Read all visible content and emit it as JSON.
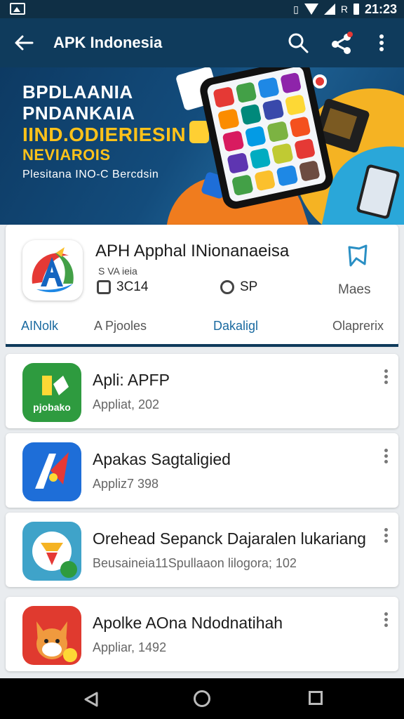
{
  "status_bar": {
    "time": "21:23",
    "vibrate_icon": "vibrate-icon",
    "data_icon": "R"
  },
  "app_bar": {
    "title": "APK Indonesia",
    "icons": [
      "back-arrow-icon",
      "search-icon",
      "share-icon",
      "more-vertical-icon"
    ]
  },
  "banner": {
    "lines": [
      "BPDLAANIA",
      "PNDANKAIA",
      "IIND.ODIERIESIN",
      "NEVIAROIS",
      "Plesitana INO-C Bercdsin"
    ]
  },
  "featured": {
    "name": "APH Apphal INionanaeisa",
    "sub": "S VA ieia",
    "rating": "3C14",
    "size": "SP",
    "bookmark_label": "Maes",
    "tabs": [
      "AINolk",
      "A Pjooles",
      "Dakaligl",
      "Olaprerix"
    ],
    "accent": "#1a6aa0"
  },
  "apps": [
    {
      "name": "Apli: APFP",
      "meta": "Appliat, 202",
      "icon_label": "pjobako",
      "icon_color": "#2e9b3f"
    },
    {
      "name": "Apakas Sagtaligied",
      "meta": "Appliz7 398",
      "icon_label": "",
      "icon_color": "#1e6ed8"
    },
    {
      "name": "Orehead Sepanck Dajaralen lukariang",
      "meta": "Beusaineia11Spullaaon lilogora; 102",
      "icon_label": "",
      "icon_color": "#3fa3c9"
    },
    {
      "name": "Apolke AOna Ndodnatihah",
      "meta": "Appliar, 1492",
      "icon_label": "",
      "icon_color": "#e03a2f"
    }
  ],
  "navigation": {
    "icons": [
      "nav-back-icon",
      "nav-home-icon",
      "nav-recents-icon"
    ]
  }
}
